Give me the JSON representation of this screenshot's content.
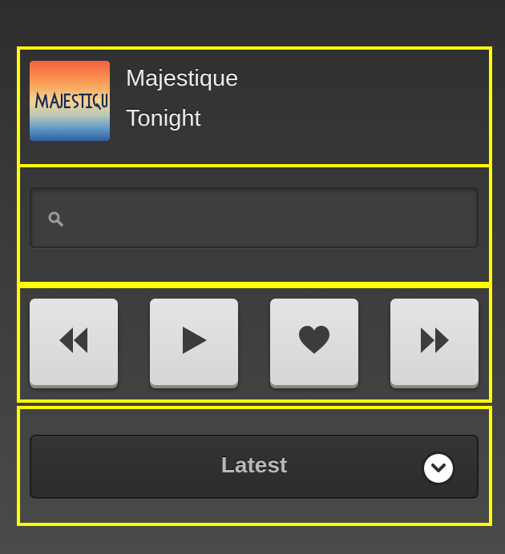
{
  "now_playing": {
    "artist": "Majestique",
    "title": "Tonight",
    "album_art_text": "MAJESTIQUE"
  },
  "search": {
    "placeholder": "",
    "value": "",
    "icon": "search-icon"
  },
  "controls": [
    {
      "name": "rewind",
      "icon": "rewind-icon"
    },
    {
      "name": "play",
      "icon": "play-icon"
    },
    {
      "name": "favorite",
      "icon": "heart-icon"
    },
    {
      "name": "fast-forward",
      "icon": "fast-forward-icon"
    }
  ],
  "filter": {
    "selected": "Latest",
    "icon": "chevron-down-icon"
  },
  "colors": {
    "highlight_border": "#ffff00",
    "button_face": "#dedede",
    "icon_dark": "#3c3c3c"
  }
}
